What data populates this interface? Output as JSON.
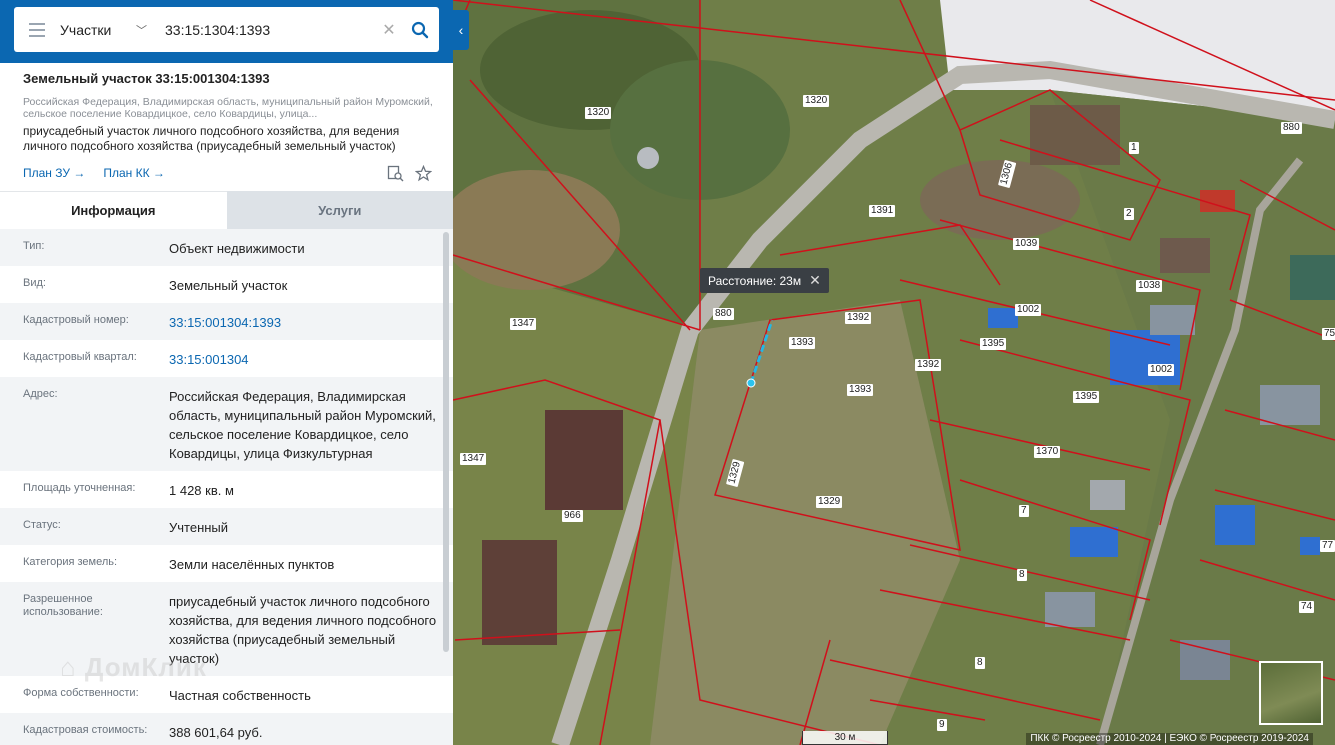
{
  "search": {
    "type_label": "Участки",
    "query": "33:15:1304:1393"
  },
  "card": {
    "title": "Земельный участок 33:15:001304:1393",
    "address_short": "Российская Федерация, Владимирская область, муниципальный район Муромский, сельское поселение Ковардицкое, село Ковардицы, улица...",
    "purpose": "приусадебный участок личного подсобного хозяйства, для ведения личного подсобного хозяйства (приусадебный земельный участок)",
    "link_plan_zu": "План ЗУ →",
    "link_plan_kk": "План КК →",
    "icons": [
      "map-search-icon",
      "star-icon"
    ]
  },
  "tabs": [
    {
      "label": "Информация",
      "active": true
    },
    {
      "label": "Услуги",
      "active": false
    }
  ],
  "info_rows": [
    {
      "key": "Тип:",
      "value": "Объект недвижимости",
      "link": false
    },
    {
      "key": "Вид:",
      "value": "Земельный участок",
      "link": false
    },
    {
      "key": "Кадастровый номер:",
      "value": "33:15:001304:1393",
      "link": true
    },
    {
      "key": "Кадастровый квартал:",
      "value": "33:15:001304",
      "link": true
    },
    {
      "key": "Адрес:",
      "value": "Российская Федерация, Владимирская область, муниципальный район Муромский, сельское поселение Ковардицкое, село Ковардицы, улица Физкультурная",
      "link": false
    },
    {
      "key": "Площадь уточненная:",
      "value": "1 428 кв. м",
      "link": false
    },
    {
      "key": "Статус:",
      "value": "Учтенный",
      "link": false
    },
    {
      "key": "Категория земель:",
      "value": "Земли населённых пунктов",
      "link": false
    },
    {
      "key": "Разрешенное использование:",
      "value": "приусадебный участок личного подсобного хозяйства, для ведения личного подсобного хозяйства (приусадебный земельный участок)",
      "link": false
    },
    {
      "key": "Форма собственности:",
      "value": "Частная собственность",
      "link": false
    },
    {
      "key": "Кадастровая стоимость:",
      "value": "388 601,64 руб.",
      "link": false
    }
  ],
  "watermark": "ДомКлик",
  "map": {
    "distance_label": "Расстояние: 23м",
    "scale_label": "30 м",
    "attribution": "ПКК © Росреестр 2010-2024 | ЕЭКО © Росреестр 2019-2024",
    "plot_labels": [
      "1320",
      "1320",
      "880",
      "1",
      "1306",
      "2",
      "1391",
      "1039",
      "1038",
      "880",
      "1392",
      "1002",
      "1393",
      "1395",
      "1392",
      "1002",
      "1347",
      "1393",
      "1395",
      "1370",
      "1347",
      "1329",
      "1329",
      "966",
      "7",
      "8",
      "8",
      "9",
      "74",
      "75",
      "77"
    ],
    "colors": {
      "parcel_border": "#d0101b",
      "road": "#b9b7b0",
      "panel_blue": "#0b67b1",
      "roof_blue": "#2f6fd1",
      "roof_red": "#c0392b"
    }
  }
}
